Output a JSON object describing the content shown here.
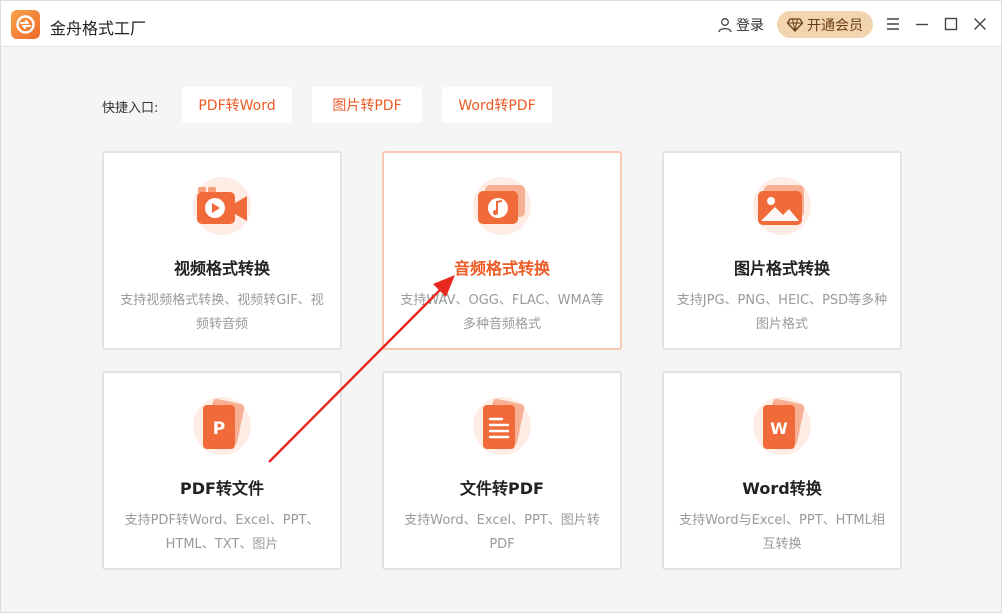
{
  "app": {
    "title": "金舟格式工厂"
  },
  "header": {
    "login_label": "登录",
    "vip_label": "开通会员"
  },
  "window_controls": [
    "menu-icon",
    "minimize-icon",
    "maximize-icon",
    "close-icon"
  ],
  "quick_entry": {
    "label": "快捷入口:",
    "items": [
      "PDF转Word",
      "图片转PDF",
      "Word转PDF"
    ]
  },
  "cards": [
    {
      "icon": "video-icon",
      "title": "视频格式转换",
      "desc": "支持视频格式转换、视频转GIF、视频转音频",
      "active": false
    },
    {
      "icon": "audio-icon",
      "title": "音频格式转换",
      "desc": "支持WAV、OGG、FLAC、WMA等多种音频格式",
      "active": true
    },
    {
      "icon": "image-icon",
      "title": "图片格式转换",
      "desc": "支持JPG、PNG、HEIC、PSD等多种图片格式",
      "active": false
    },
    {
      "icon": "pdf-icon",
      "title": "PDF转文件",
      "desc": "支持PDF转Word、Excel、PPT、HTML、TXT、图片",
      "active": false
    },
    {
      "icon": "document-icon",
      "title": "文件转PDF",
      "desc": "支持Word、Excel、PPT、图片转PDF",
      "active": false
    },
    {
      "icon": "word-icon",
      "title": "Word转换",
      "desc": "支持Word与Excel、PPT、HTML相互转换",
      "active": false
    }
  ],
  "colors": {
    "accent": "#ee5a24",
    "vip_bg": "#f2d5b0",
    "annotation_arrow": "#e8281f"
  }
}
